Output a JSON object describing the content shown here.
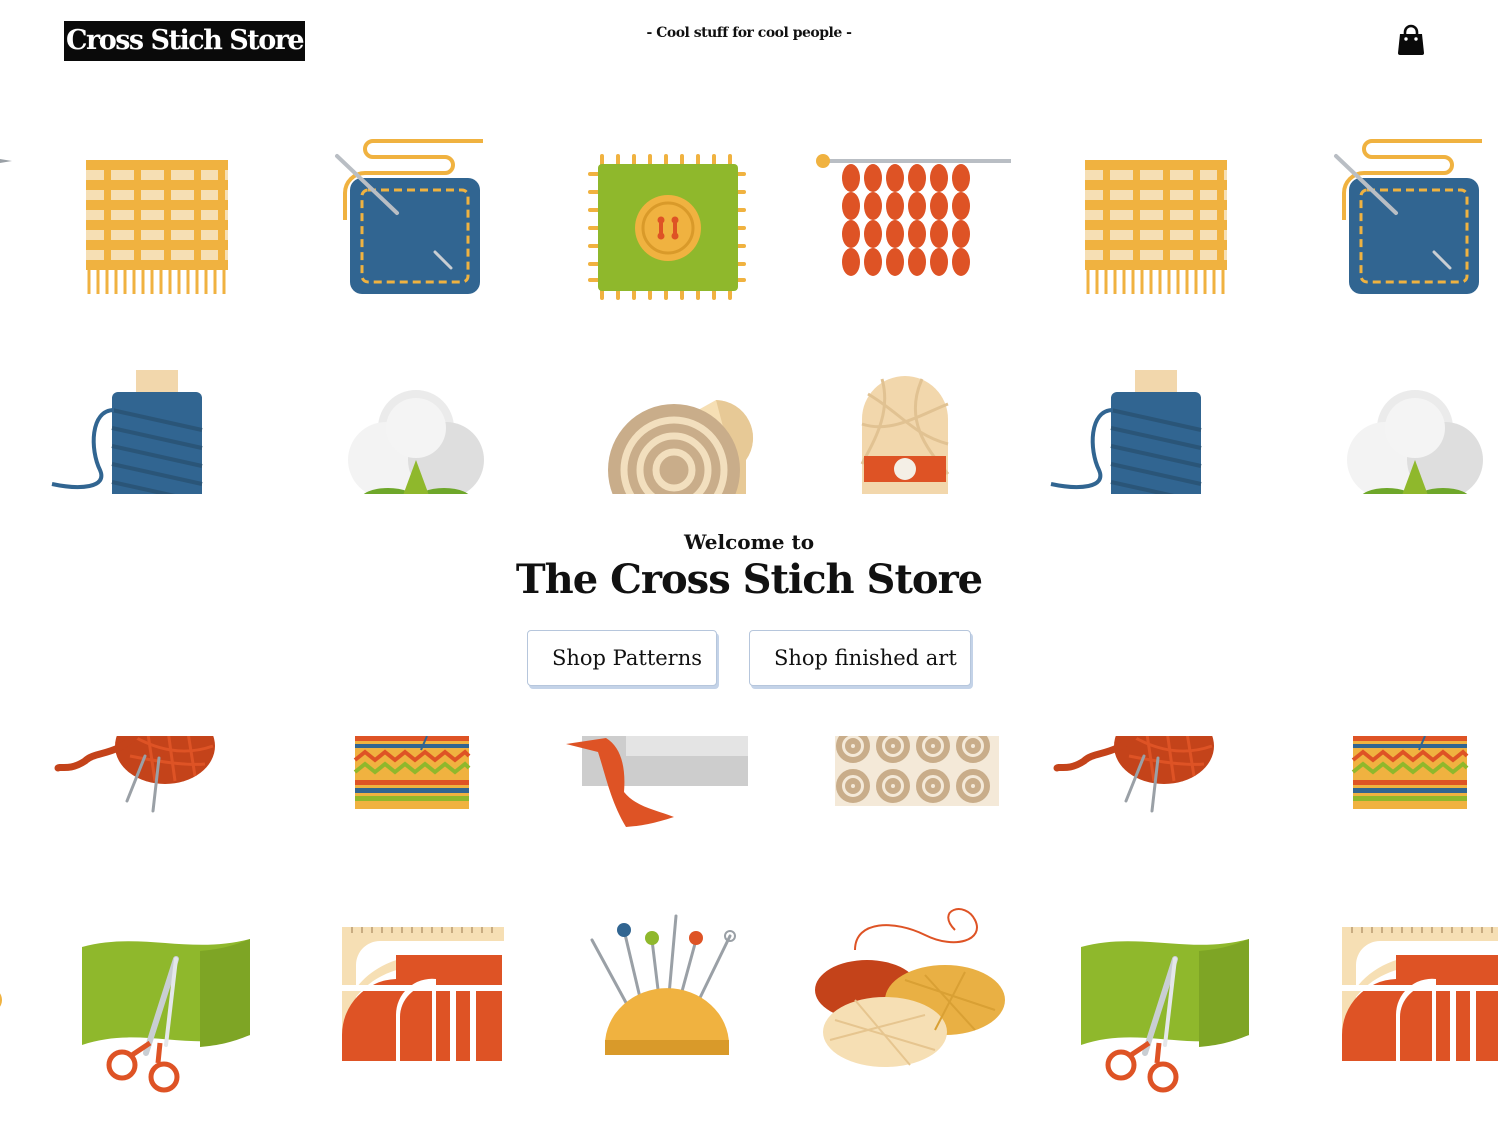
{
  "header": {
    "logo_text": "Cross Stich Store",
    "tagline": "- Cool stuff for cool people -",
    "cart_icon": "shopping-bag-icon"
  },
  "hero": {
    "welcome": "Welcome to",
    "title": "The Cross Stich Store",
    "buttons": {
      "patterns": "Shop Patterns",
      "finished_art": "Shop finished art"
    }
  },
  "decorative_rows": {
    "row1": [
      "striped-fabric-icon",
      "denim-patch-icon",
      "button-patch-icon",
      "knitting-icon"
    ],
    "row2": [
      "thread-spool-icon",
      "cotton-icon",
      "fabric-roll-icon",
      "yarn-skein-icon"
    ],
    "row3": [
      "yarn-ball-icon",
      "zigzag-fabric-icon",
      "ribbon-icon",
      "swirl-fabric-icon"
    ],
    "row4": [
      "fabric-scissors-icon",
      "ruler-pattern-icon",
      "pincushion-icon",
      "yarn-balls-icon"
    ]
  },
  "colors": {
    "orange": "#de5325",
    "yellow": "#f0b240",
    "blue": "#316591",
    "green": "#8fb82c",
    "beige": "#f6dfb4",
    "ink": "#0a0a0a"
  }
}
